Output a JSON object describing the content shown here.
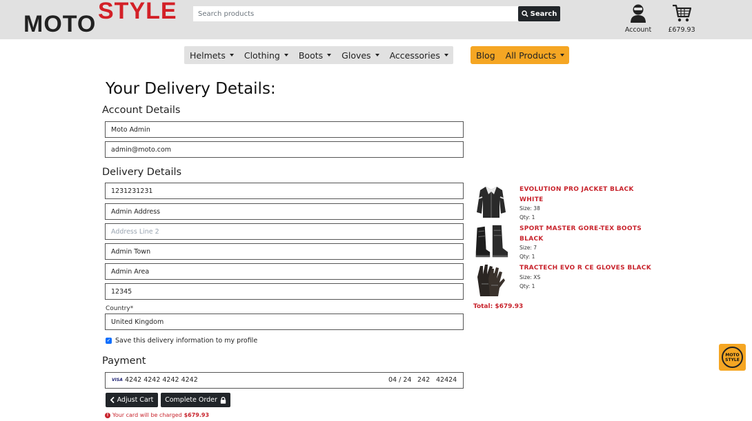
{
  "header": {
    "logo_part1": "MOTO",
    "logo_part2": "STYLE",
    "search_placeholder": "Search products",
    "search_button": "Search",
    "account_label": "Account",
    "cart_total": "£679.93"
  },
  "nav": {
    "items": [
      {
        "label": "Helmets"
      },
      {
        "label": "Clothing"
      },
      {
        "label": "Boots"
      },
      {
        "label": "Gloves"
      },
      {
        "label": "Accessories"
      }
    ],
    "blog": "Blog",
    "all_products": "All Products"
  },
  "page": {
    "title": "Your Delivery Details:",
    "account_section": "Account Details",
    "delivery_section": "Delivery Details",
    "payment_section": "Payment"
  },
  "form": {
    "full_name": "Moto Admin",
    "email": "admin@moto.com",
    "phone": "1231231231",
    "address1": "Admin Address",
    "address2_placeholder": "Address Line 2",
    "town": "Admin Town",
    "county": "Admin Area",
    "postcode": "12345",
    "country_label": "Country*",
    "country": "United Kingdom",
    "save_info_label": "Save this delivery information to my profile",
    "save_info_checked": true
  },
  "payment": {
    "card_brand": "VISA",
    "card_number": "4242 4242 4242 4242",
    "expiry": "04 / 24",
    "cvc": "242",
    "zip": "42424",
    "adjust_cart": "Adjust Cart",
    "complete_order": "Complete Order",
    "charge_prefix": "Your card will be charged",
    "charge_amount": "$679.93"
  },
  "order": {
    "items": [
      {
        "name": "EVOLUTION PRO JACKET BLACK WHITE",
        "size": "Size: 38",
        "qty": "Qty: 1",
        "icon": "jacket-icon"
      },
      {
        "name": "SPORT MASTER GORE-TEX BOOTS BLACK",
        "size": "Size: 7",
        "qty": "Qty: 1",
        "icon": "boots-icon"
      },
      {
        "name": "TRACTECH EVO R CE GLOVES BLACK",
        "size": "Size: XS",
        "qty": "Qty: 1",
        "icon": "gloves-icon"
      }
    ],
    "total": "Total: $679.93"
  },
  "badge": {
    "text_line1": "MOTO",
    "text_line2": "STYLE"
  },
  "colors": {
    "brand_red": "#d32027",
    "accent_orange": "#f5a623",
    "dark": "#212529",
    "header_bg": "#e1e1e1"
  }
}
